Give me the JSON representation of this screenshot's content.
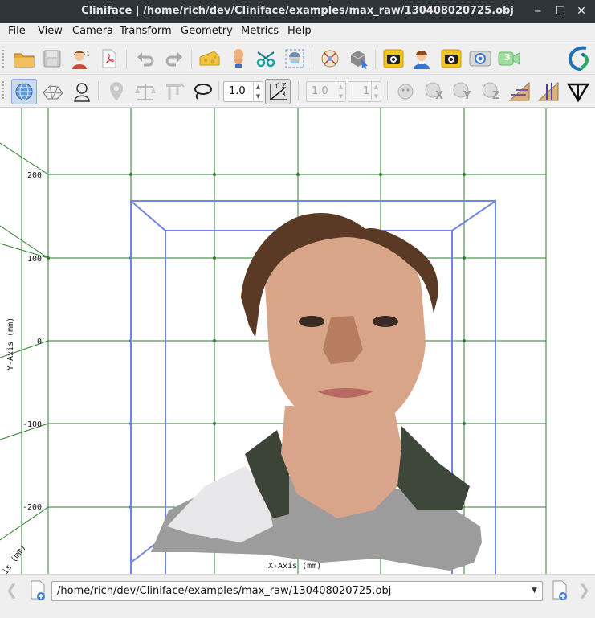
{
  "window": {
    "title": "Cliniface | /home/rich/dev/Cliniface/examples/max_raw/130408020725.obj",
    "minimize_icon": "minimize-icon",
    "maximize_icon": "maximize-icon",
    "close_icon": "close-icon"
  },
  "menu": [
    "File",
    "View",
    "Camera",
    "Transform",
    "Geometry",
    "Metrics",
    "Help"
  ],
  "toolbar2": {
    "scale_value": "1.0",
    "disabled_scale": "1.0",
    "disabled_count": "1",
    "axes_button_labels": [
      "Y",
      "Z",
      "X"
    ],
    "rotate_labels": [
      "X",
      "Y",
      "Z"
    ]
  },
  "toolbar1": {
    "camera_badge": "3"
  },
  "viewport": {
    "y_ticks": [
      "200",
      "100",
      "0",
      "-100",
      "-200"
    ],
    "y_axis_label": "Y-Axis (mm)",
    "x_axis_label": "X-Axis (mm)",
    "z_axis_label": "is (mm)",
    "colors": {
      "grid": "#2e7d2e",
      "bbox": "#6f86e6",
      "background": "#ffffff"
    }
  },
  "statusbar": {
    "file_path": "/home/rich/dev/Cliniface/examples/max_raw/130408020725.obj"
  }
}
